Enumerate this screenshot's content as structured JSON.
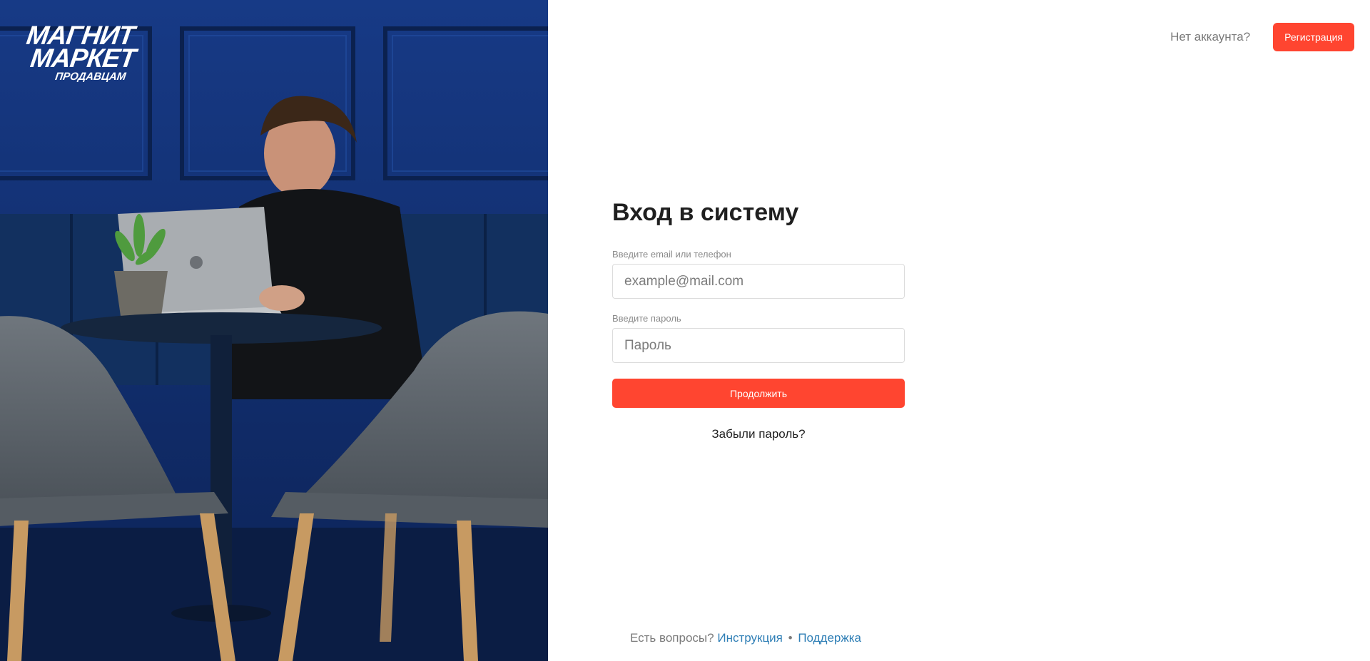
{
  "brand": {
    "logo_line1": "МАГНИТ",
    "logo_line2": "МАРКЕТ",
    "logo_line3": "ПРОДАВЦАМ"
  },
  "header": {
    "no_account_text": "Нет аккаунта?",
    "register_label": "Регистрация"
  },
  "login": {
    "title": "Вход в систему",
    "email_label": "Введите email или телефон",
    "email_placeholder": "example@mail.com",
    "email_value": "",
    "password_label": "Введите пароль",
    "password_placeholder": "Пароль",
    "password_value": "",
    "submit_label": "Продолжить",
    "forgot_label": "Забыли пароль?"
  },
  "footer": {
    "questions_text": "Есть вопросы?",
    "instruction_label": "Инструкция",
    "separator": "•",
    "support_label": "Поддержка"
  },
  "colors": {
    "accent": "#ff4530",
    "link": "#2f7fb6",
    "hero_background": "#0f2a66"
  }
}
